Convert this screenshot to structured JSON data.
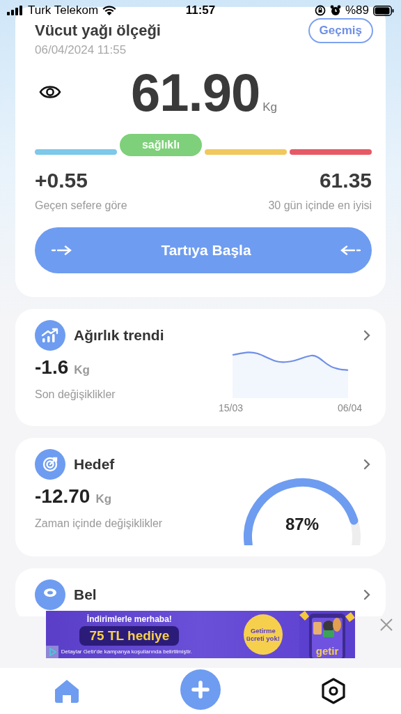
{
  "status_bar": {
    "carrier": "Turk Telekom",
    "time": "11:57",
    "battery": "%89"
  },
  "scale": {
    "title": "Vücut yağı ölçeği",
    "history_button": "Geçmiş",
    "date": "06/04/2024 11:55",
    "weight": "61.90",
    "unit": "Kg",
    "status_label": "sağlıklı",
    "segments": [
      {
        "color": "#7ec8ea",
        "selected": false
      },
      {
        "color": "#7ed07a",
        "selected": true
      },
      {
        "color": "#f0c85e",
        "selected": false
      },
      {
        "color": "#e65a66",
        "selected": false
      }
    ],
    "stats": [
      {
        "value": "+0.55",
        "label": "Geçen sefere göre"
      },
      {
        "value": "61.35",
        "label": "30 gün içinde en iyisi"
      }
    ],
    "start_button": "Tartıya Başla"
  },
  "cards": [
    {
      "kind": "trend",
      "title": "Ağırlık trendi",
      "value": "-1.6",
      "unit": "Kg",
      "caption": "Son değişiklikler",
      "x_labels": [
        "15/03",
        "06/04"
      ]
    },
    {
      "kind": "goal",
      "title": "Hedef",
      "value": "-12.70",
      "unit": "Kg",
      "caption": "Zaman içinde değişiklikler",
      "percent": "87%"
    },
    {
      "kind": "waist",
      "title": "Bel"
    }
  ],
  "ad": {
    "headline": "İndirimlerle merhaba!",
    "offer": "75 TL hediye",
    "badge": "Getirme ücreti yok!",
    "brand": "getir",
    "disclaimer": "Detaylar Getir'de kampanya koşullarında belirtilmiştir."
  }
}
